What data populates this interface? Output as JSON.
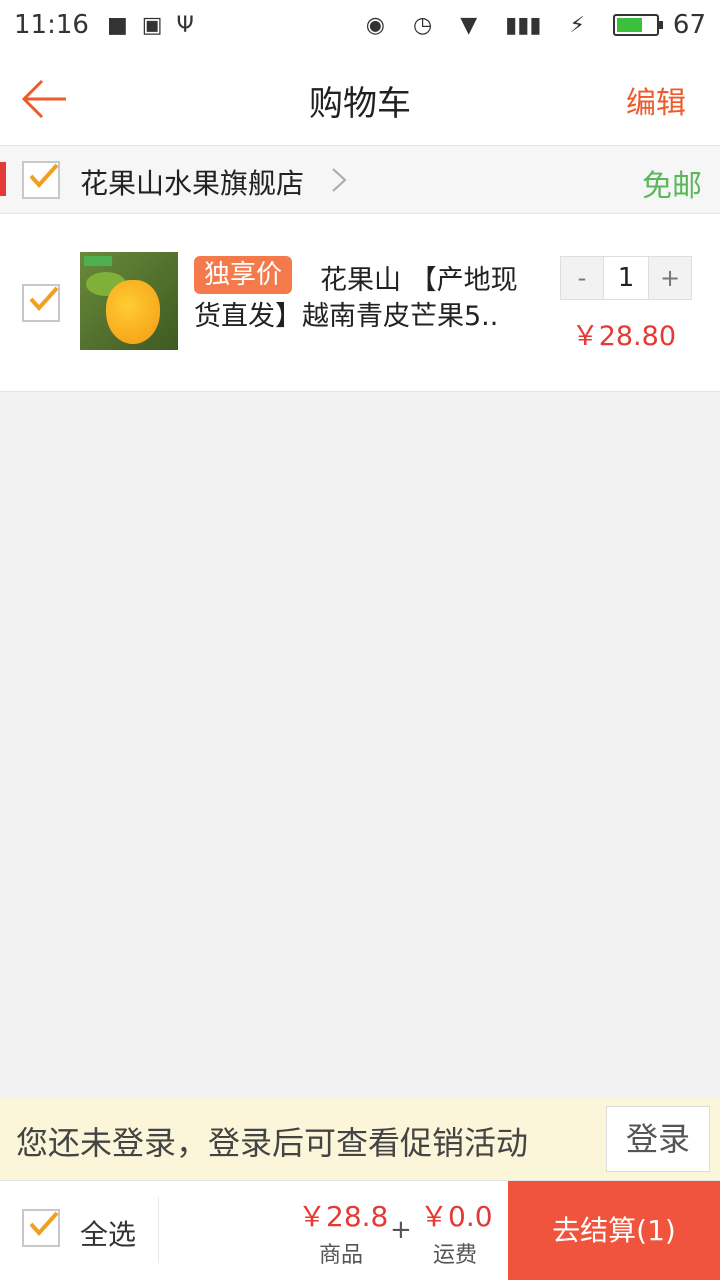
{
  "status_bar": {
    "time": "11:16",
    "battery_level": "67"
  },
  "header": {
    "title": "购物车",
    "edit_label": "编辑"
  },
  "store": {
    "name": "花果山水果旗舰店",
    "shipping": "免邮"
  },
  "product": {
    "badge": "独享价",
    "name_line1": "花果山 【产地现",
    "name_line2": "货直发】越南青皮芒果5..",
    "quantity": "1",
    "decrement": "-",
    "increment": "+",
    "price": "￥28.80"
  },
  "login_bar": {
    "message": "您还未登录，登录后可查看促销活动",
    "button": "登录"
  },
  "bottom": {
    "select_all": "全选",
    "goods_amount": "￥28.8",
    "goods_label": "商品",
    "plus": "+",
    "freight_amount": "￥0.0",
    "freight_label": "运费",
    "checkout": "去结算(1)"
  },
  "colors": {
    "accent": "#ef5a2b",
    "price": "#e53935",
    "free_shipping": "#5ab85a",
    "checkout_bg": "#f0543c",
    "check": "#f0a020"
  }
}
